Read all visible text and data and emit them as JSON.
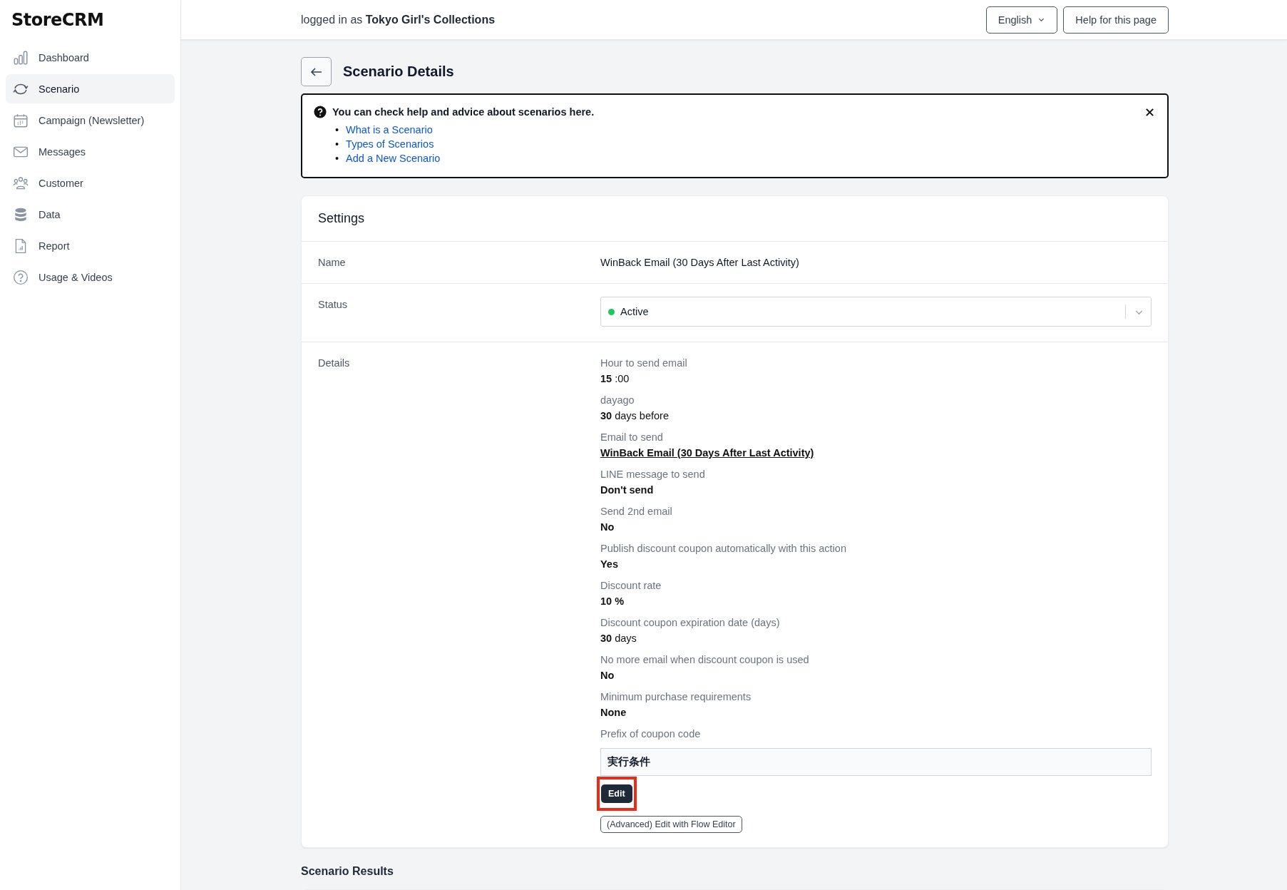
{
  "sidebar": {
    "logo": "StoreCRM",
    "items": [
      {
        "label": "Dashboard",
        "selected": false
      },
      {
        "label": "Scenario",
        "selected": true
      },
      {
        "label": "Campaign (Newsletter)",
        "selected": false
      },
      {
        "label": "Messages",
        "selected": false
      },
      {
        "label": "Customer",
        "selected": false
      },
      {
        "label": "Data",
        "selected": false
      },
      {
        "label": "Report",
        "selected": false
      },
      {
        "label": "Usage & Videos",
        "selected": false
      }
    ]
  },
  "header": {
    "login_text": "logged in as **Tokyo Girl's Collections**",
    "language": "English",
    "help_button": "Help for this page"
  },
  "page_title": "Scenario Details",
  "help_box": {
    "title": "You can check help and advice about scenarios here.",
    "links": [
      {
        "marker": "•",
        "label": "What is a Scenario"
      },
      {
        "marker": "•",
        "label": "Types of Scenarios"
      },
      {
        "marker": "•",
        "label": "Add a New Scenario"
      }
    ]
  },
  "settings": {
    "title": "Settings",
    "name": {
      "label": "Name",
      "value": "WinBack Email (30 Days After Last Activity)"
    },
    "status": {
      "label": "Status",
      "value": "Active",
      "color": "#22c55e"
    },
    "details": {
      "label": "Details",
      "items": [
        {
          "label": "Hour to send email",
          "value": "**15** :00",
          "kind": "mixed"
        },
        {
          "label": "dayago",
          "value": "**30** days before",
          "kind": "mixed"
        },
        {
          "label": "Email to send",
          "value": "WinBack Email (30 Days After Last Activity)",
          "kind": "link"
        },
        {
          "label": "LINE message to send",
          "value": "Don't send",
          "kind": "plain"
        },
        {
          "label": "Send 2nd email",
          "value": "No",
          "kind": "plain"
        },
        {
          "label": "Publish discount coupon automatically with this action",
          "value": "Yes",
          "kind": "plain"
        },
        {
          "label": "Discount rate",
          "value": "10 %",
          "kind": "plain"
        },
        {
          "label": "Discount coupon expiration date (days)",
          "value": "**30** days",
          "kind": "mixed"
        },
        {
          "label": "No more email when discount coupon is used",
          "value": "No",
          "kind": "plain"
        },
        {
          "label": "Minimum purchase requirements",
          "value": "None",
          "kind": "plain"
        },
        {
          "label": "Prefix of coupon code",
          "kind": "none"
        }
      ],
      "conditions": "実行条件",
      "edit_button": {
        "label": "Edit",
        "highlighted": true
      },
      "flow_button": "(Advanced) Edit with Flow Editor"
    }
  },
  "results_title": "Scenario Results"
}
